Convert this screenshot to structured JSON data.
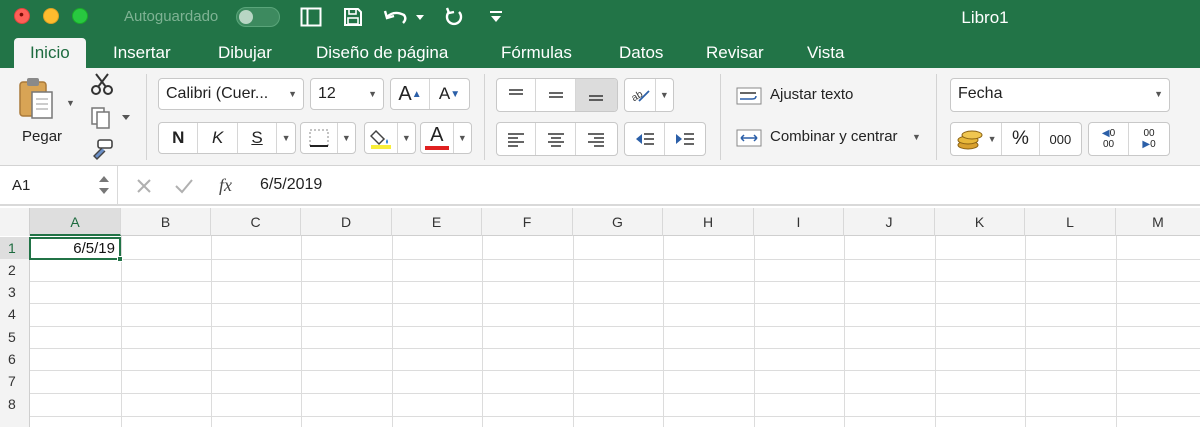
{
  "window": {
    "title": "Libro1",
    "autosave_label": "Autoguardado"
  },
  "tabs": [
    {
      "label": "Inicio",
      "active": true
    },
    {
      "label": "Insertar"
    },
    {
      "label": "Dibujar"
    },
    {
      "label": "Diseño de página"
    },
    {
      "label": "Fórmulas"
    },
    {
      "label": "Datos"
    },
    {
      "label": "Revisar"
    },
    {
      "label": "Vista"
    }
  ],
  "ribbon": {
    "paste_label": "Pegar",
    "font_name": "Calibri (Cuer...",
    "font_size": "12",
    "bold": "N",
    "italic": "K",
    "underline": "S",
    "font_color_letter": "A",
    "grow_font": "A",
    "shrink_font": "A",
    "wrap_text": "Ajustar texto",
    "merge_center": "Combinar y centrar",
    "number_format": "Fecha",
    "percent": "%",
    "thousands": "000",
    "inc_decimal_top": "0",
    "inc_decimal_bottom": "00",
    "dec_decimal_top": "00",
    "dec_decimal_bottom": "0",
    "colors": {
      "highlight": "#f8ee3a",
      "font_color": "#e02020"
    }
  },
  "formula_bar": {
    "name_box": "A1",
    "fx": "fx",
    "value": "6/5/2019"
  },
  "sheet": {
    "columns": [
      "A",
      "B",
      "C",
      "D",
      "E",
      "F",
      "G",
      "H",
      "I",
      "J",
      "K",
      "L",
      "M"
    ],
    "rows": [
      "1",
      "2",
      "3",
      "4",
      "5",
      "6",
      "7",
      "8"
    ],
    "cell_a1": "6/5/19"
  },
  "theme": {
    "accent": "#227447"
  }
}
